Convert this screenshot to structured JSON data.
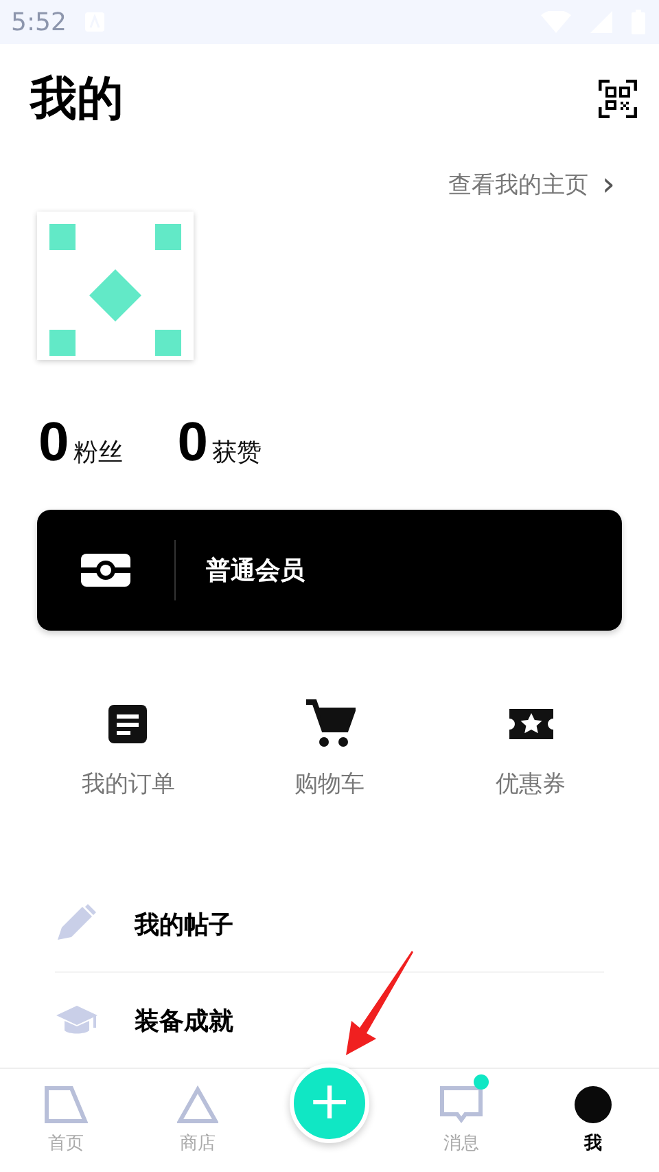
{
  "status_bar": {
    "time": "5:52"
  },
  "header": {
    "title": "我的"
  },
  "profile": {
    "homepage_link": "查看我的主页",
    "chevron": "›"
  },
  "stats": [
    {
      "value": "0",
      "label": "粉丝"
    },
    {
      "value": "0",
      "label": "获赞"
    }
  ],
  "membership": {
    "label": "普通会员"
  },
  "shortcuts": [
    {
      "kind": "orders",
      "label": "我的订单"
    },
    {
      "kind": "cart",
      "label": "购物车"
    },
    {
      "kind": "coupon",
      "label": "优惠券"
    }
  ],
  "menu": [
    {
      "kind": "posts",
      "label": "我的帖子"
    },
    {
      "kind": "achievements",
      "label": "装备成就"
    }
  ],
  "nav": [
    {
      "kind": "home",
      "label": "首页",
      "selected": false,
      "dot": false
    },
    {
      "kind": "shop",
      "label": "商店",
      "selected": false,
      "dot": false
    },
    {
      "kind": "add",
      "label": "+"
    },
    {
      "kind": "message",
      "label": "消息",
      "selected": false,
      "dot": true
    },
    {
      "kind": "me",
      "label": "我",
      "selected": true,
      "dot": false
    }
  ]
}
